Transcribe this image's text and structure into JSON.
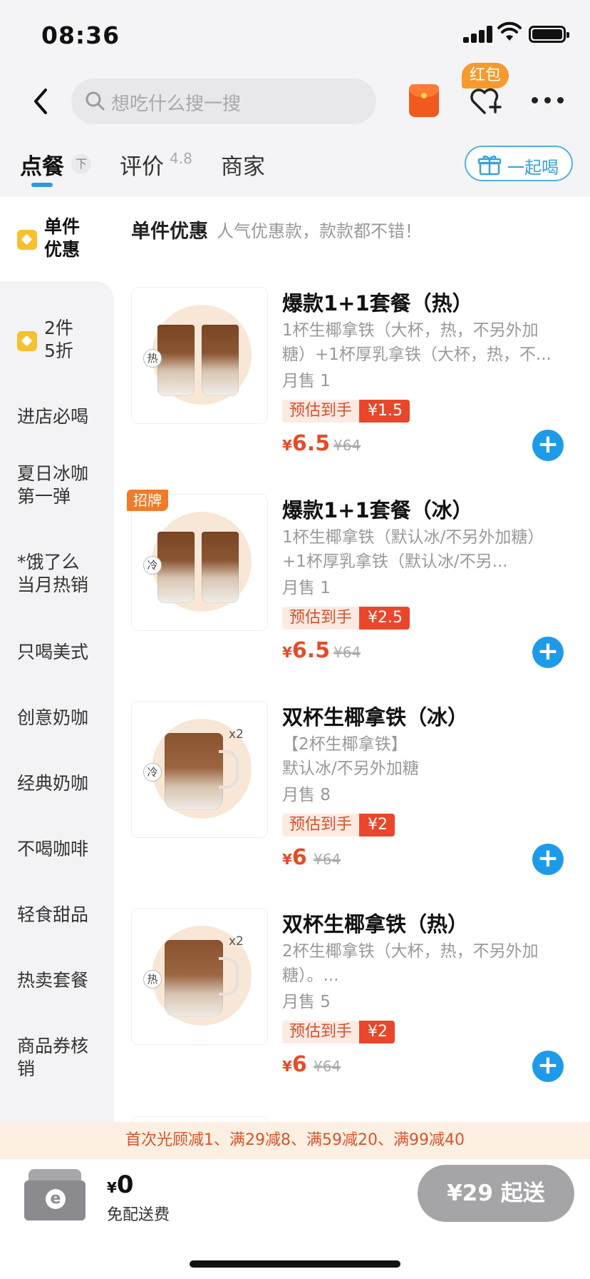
{
  "status_bar": {
    "time": "08:36"
  },
  "header": {
    "search_placeholder": "想吃什么搜一搜",
    "red_packet_badge": "红包",
    "icons": [
      "back-icon",
      "search-icon",
      "red-packet-icon",
      "favorite-add-icon",
      "more-icon"
    ]
  },
  "tabs": {
    "order": "点餐",
    "reviews": "评价",
    "rating": "4.8",
    "merchant": "商家",
    "pin": "下"
  },
  "together_button": {
    "label": "一起喝"
  },
  "sidebar": {
    "items": [
      {
        "label": "单件\n优惠"
      },
      {
        "label": "2件\n5折"
      },
      {
        "label": "进店必喝"
      },
      {
        "label": "夏日冰咖\n第一弹"
      },
      {
        "label": "*饿了么\n当月热销"
      },
      {
        "label": "只喝美式"
      },
      {
        "label": "创意奶咖"
      },
      {
        "label": "经典奶咖"
      },
      {
        "label": "不喝咖啡"
      },
      {
        "label": "轻食甜品"
      },
      {
        "label": "热卖套餐"
      },
      {
        "label": "商品券核\n销"
      }
    ]
  },
  "section": {
    "title": "单件优惠",
    "subtitle": "人气优惠款，款款都不错！"
  },
  "products": [
    {
      "name": "爆款1+1套餐（热）",
      "desc": "1杯生椰拿铁（大杯，热，不另外加糖）+1杯厚乳拿铁（大杯，热，不...",
      "sold": "月售 1",
      "est_label": "预估到手",
      "est_price": "¥1.5",
      "currency": "¥",
      "price": "6.5",
      "orig": "¥64",
      "temp": "热"
    },
    {
      "name": "爆款1+1套餐（冰）",
      "desc": "1杯生椰拿铁（默认冰/不另外加糖）+1杯厚乳拿铁（默认冰/不另...",
      "sold": "月售 1",
      "est_label": "预估到手",
      "est_price": "¥2.5",
      "currency": "¥",
      "price": "6.5",
      "orig": "¥64",
      "temp": "冷",
      "badge": "招牌"
    },
    {
      "name": "双杯生椰拿铁（冰）",
      "desc": "【2杯生椰拿铁】\n默认冰/不另外加糖",
      "sold": "月售 8",
      "est_label": "预估到手",
      "est_price": "¥2",
      "currency": "¥",
      "price": "6",
      "orig": "¥64",
      "temp": "冷",
      "multiplier": "x2"
    },
    {
      "name": "双杯生椰拿铁（热）",
      "desc": "2杯生椰拿铁（大杯，热，不另外加糖）。...",
      "sold": "月售 5",
      "est_label": "预估到手",
      "est_price": "¥2",
      "currency": "¥",
      "price": "6",
      "orig": "¥64",
      "temp": "热",
      "multiplier": "x2"
    }
  ],
  "promo": "首次光顾减1、满29减8、满59减20、满99减40",
  "cart": {
    "currency": "¥",
    "total": "0",
    "delivery": "免配送费",
    "checkout": "¥29 起送"
  },
  "colors": {
    "accent": "#1e9be8",
    "price": "#e54b2a",
    "promo_bg": "#fdf0e2"
  }
}
